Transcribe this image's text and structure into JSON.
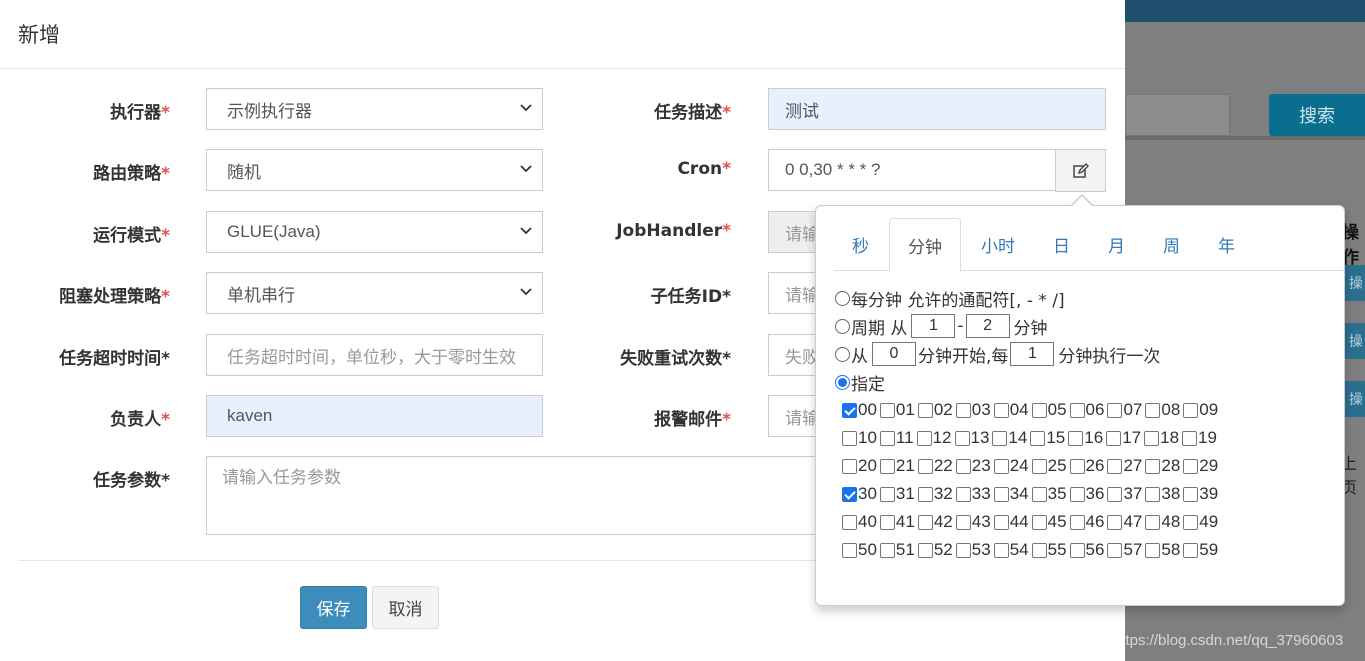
{
  "background": {
    "search_button": "搜索",
    "operation_header": "操作",
    "page_text": "上页",
    "watermark": "https://blog.csdn.net/qq_37960603",
    "op_button_text": "操"
  },
  "modal": {
    "title": "新增",
    "left_fields": [
      {
        "label": "执行器",
        "required": true,
        "value": "示例执行器",
        "type": "select"
      },
      {
        "label": "路由策略",
        "required": true,
        "value": "随机",
        "type": "select"
      },
      {
        "label": "运行模式",
        "required": true,
        "value": "GLUE(Java)",
        "type": "select"
      },
      {
        "label": "阻塞处理策略",
        "required": true,
        "value": "单机串行",
        "type": "select"
      },
      {
        "label": "任务超时时间*",
        "required": false,
        "placeholder": "任务超时时间，单位秒，大于零时生效",
        "type": "input"
      },
      {
        "label": "负责人",
        "required": true,
        "value": "kaven",
        "type": "input"
      }
    ],
    "right_fields": [
      {
        "label": "任务描述",
        "required": true,
        "value": "测试"
      },
      {
        "label": "Cron",
        "required": true,
        "value": "0 0,30 * * * ?"
      },
      {
        "label": "JobHandler",
        "required": true,
        "placeholder": "请输"
      },
      {
        "label": "子任务ID*",
        "required": false,
        "placeholder": "请输"
      },
      {
        "label": "失败重试次数*",
        "required": false,
        "placeholder": "失败"
      },
      {
        "label": "报警邮件",
        "required": true,
        "placeholder": "请输"
      }
    ],
    "params": {
      "label": "任务参数*",
      "placeholder": "请输入任务参数"
    },
    "save_label": "保存",
    "cancel_label": "取消"
  },
  "cron_popover": {
    "tabs": [
      "秒",
      "分钟",
      "小时",
      "日",
      "月",
      "周",
      "年"
    ],
    "active_tab": "分钟",
    "every": "每分钟 允许的通配符[, - * /]",
    "cycle": {
      "prefix": "周期 从",
      "from": "1",
      "sep": "-",
      "to": "2",
      "suffix": "分钟"
    },
    "interval": {
      "prefix": "从",
      "start": "0",
      "mid": "分钟开始,每",
      "step": "1",
      "suffix": "分钟执行一次"
    },
    "specify": "指定",
    "selected_option": "指定",
    "checked_minutes": [
      "00",
      "30"
    ]
  },
  "colors": {
    "primary": "#3c8dbc",
    "required": "#d9534f",
    "link": "#337ab7",
    "autofill": "#e8f0fe"
  }
}
